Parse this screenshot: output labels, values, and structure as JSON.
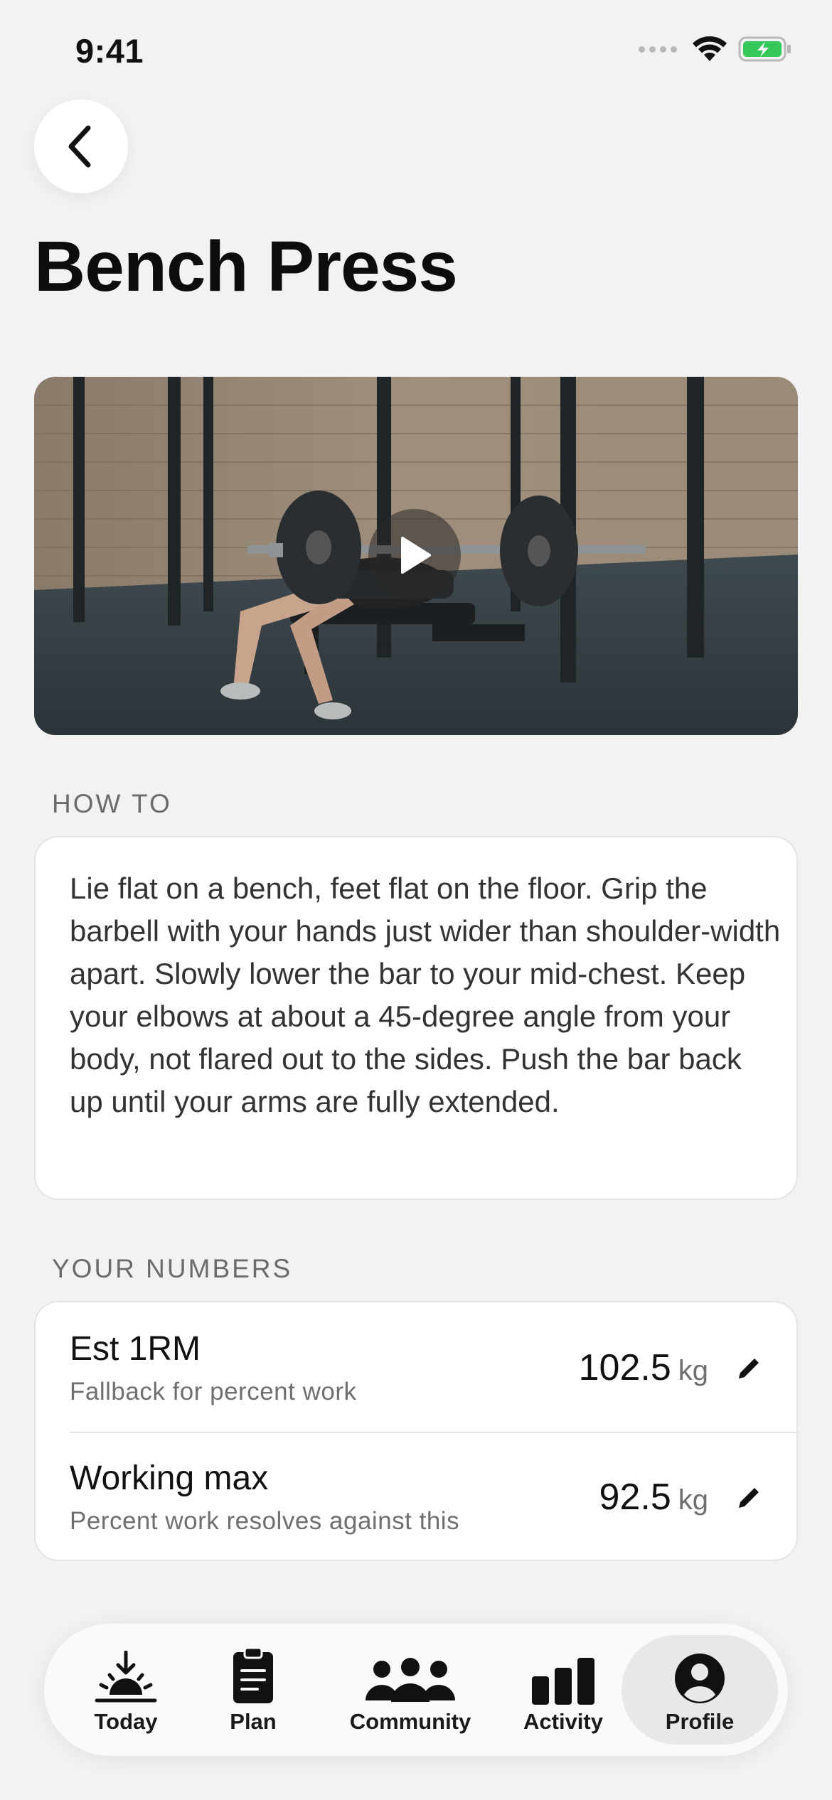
{
  "status_bar": {
    "time": "9:41",
    "icons": [
      "signal-icon",
      "wifi-icon",
      "battery-charging-icon"
    ],
    "battery_color": "#34c759"
  },
  "nav": {
    "back_icon": "chevron-left-icon"
  },
  "exercise": {
    "title": "Bench Press",
    "video_icon": "play-icon"
  },
  "how_to": {
    "section_label": "HOW TO",
    "text": "Lie flat on a bench, feet flat on the floor. Grip the barbell with your hands just wider than shoulder-width apart. Slowly lower the bar to your mid-chest. Keep your elbows at about a 45-degree angle from your body, not flared out to the sides. Push the bar back up until your arms are fully extended."
  },
  "your_numbers": {
    "section_label": "YOUR NUMBERS",
    "rows": [
      {
        "title": "Est 1RM",
        "subtitle": "Fallback for percent work",
        "value": "102.5",
        "unit": "kg",
        "edit_icon": "pencil-icon"
      },
      {
        "title": "Working max",
        "subtitle": "Percent work resolves against this",
        "value": "92.5",
        "unit": "kg",
        "edit_icon": "pencil-icon"
      }
    ]
  },
  "tab_bar": {
    "active": "Profile",
    "tabs": [
      {
        "label": "Today",
        "icon": "sunrise-icon"
      },
      {
        "label": "Plan",
        "icon": "clipboard-icon"
      },
      {
        "label": "Community",
        "icon": "people-icon"
      },
      {
        "label": "Activity",
        "icon": "bar-chart-icon"
      },
      {
        "label": "Profile",
        "icon": "person-circle-icon"
      }
    ]
  }
}
